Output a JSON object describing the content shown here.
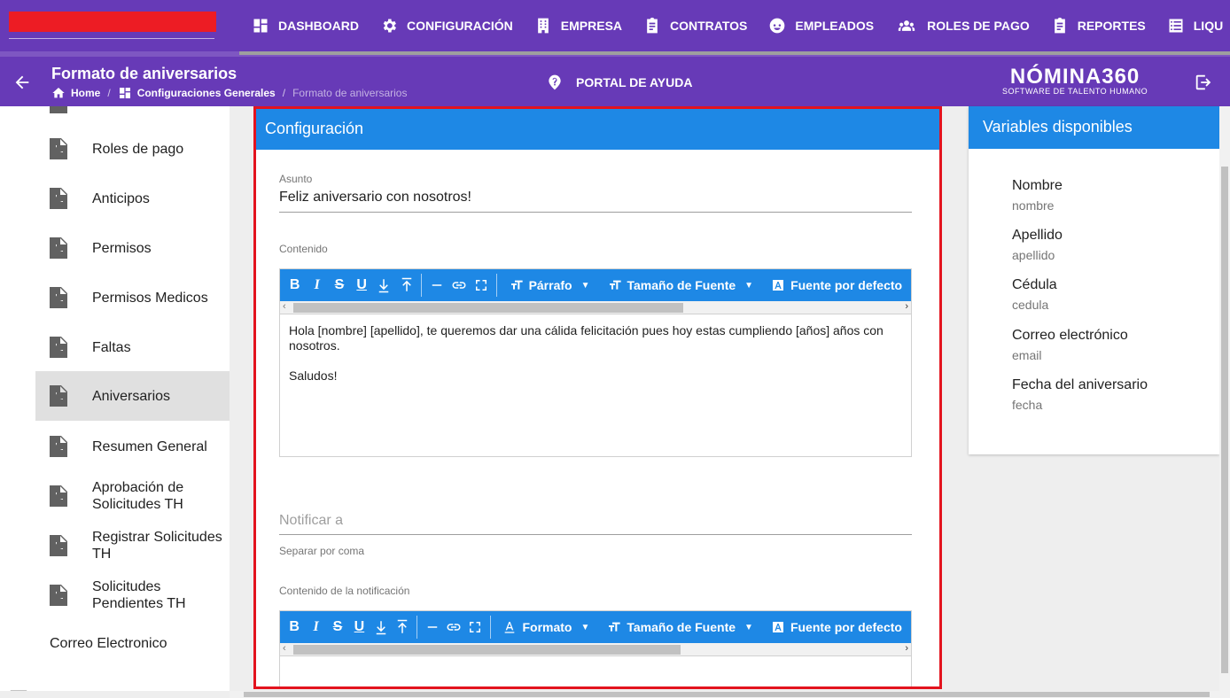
{
  "colors": {
    "nav_bg": "#673ab7",
    "accent_blue": "#1e88e5",
    "highlight_border": "#e3131e",
    "logo_red": "#ed1c24"
  },
  "nav": {
    "items": [
      {
        "label": "DASHBOARD",
        "icon": "dashboard-icon"
      },
      {
        "label": "CONFIGURACIÓN",
        "icon": "gear-icon"
      },
      {
        "label": "EMPRESA",
        "icon": "building-icon"
      },
      {
        "label": "CONTRATOS",
        "icon": "clipboard-icon"
      },
      {
        "label": "EMPLEADOS",
        "icon": "face-icon"
      },
      {
        "label": "ROLES DE PAGO",
        "icon": "people-icon"
      },
      {
        "label": "REPORTES",
        "icon": "clipboard-icon"
      },
      {
        "label": "LIQU",
        "icon": "list-icon"
      }
    ]
  },
  "header": {
    "title": "Formato de aniversarios",
    "breadcrumb": {
      "home": "Home",
      "section": "Configuraciones Generales",
      "current": "Formato de aniversarios"
    },
    "help_label": "PORTAL DE AYUDA",
    "brand_name": "NÓMINA360",
    "brand_tagline": "SOFTWARE DE TALENTO HUMANO"
  },
  "sidebar": {
    "items": [
      {
        "label": "Roles de pago"
      },
      {
        "label": "Anticipos"
      },
      {
        "label": "Permisos"
      },
      {
        "label": "Permisos Medicos"
      },
      {
        "label": "Faltas"
      },
      {
        "label": "Aniversarios",
        "active": true
      },
      {
        "label": "Resumen General"
      },
      {
        "label": "Aprobación de Solicitudes TH"
      },
      {
        "label": "Registrar Solicitudes TH"
      },
      {
        "label": "Solicitudes Pendientes TH"
      }
    ],
    "section_label": "Correo Electronico"
  },
  "config": {
    "title": "Configuración",
    "subject_label": "Asunto",
    "subject_value": "Feliz aniversario con nosotros!",
    "content_label": "Contenido",
    "editor1": {
      "format_label": "Párrafo",
      "font_size_label": "Tamaño de Fuente",
      "font_label": "Fuente por defecto",
      "line1": "Hola [nombre] [apellido], te queremos dar una cálida felicitación pues hoy estas cumpliendo [años] años con nosotros.",
      "line2": "Saludos!"
    },
    "notify_placeholder": "Notificar a",
    "notify_hint": "Separar por coma",
    "notification_label": "Contenido de la notificación",
    "editor2": {
      "format_label": "Formato",
      "font_size_label": "Tamaño de Fuente",
      "font_label": "Fuente por defecto"
    }
  },
  "variables": {
    "title": "Variables disponibles",
    "items": [
      {
        "name": "Nombre",
        "key": "nombre"
      },
      {
        "name": "Apellido",
        "key": "apellido"
      },
      {
        "name": "Cédula",
        "key": "cedula"
      },
      {
        "name": "Correo electrónico",
        "key": "email"
      },
      {
        "name": "Fecha del aniversario",
        "key": "fecha"
      }
    ]
  }
}
